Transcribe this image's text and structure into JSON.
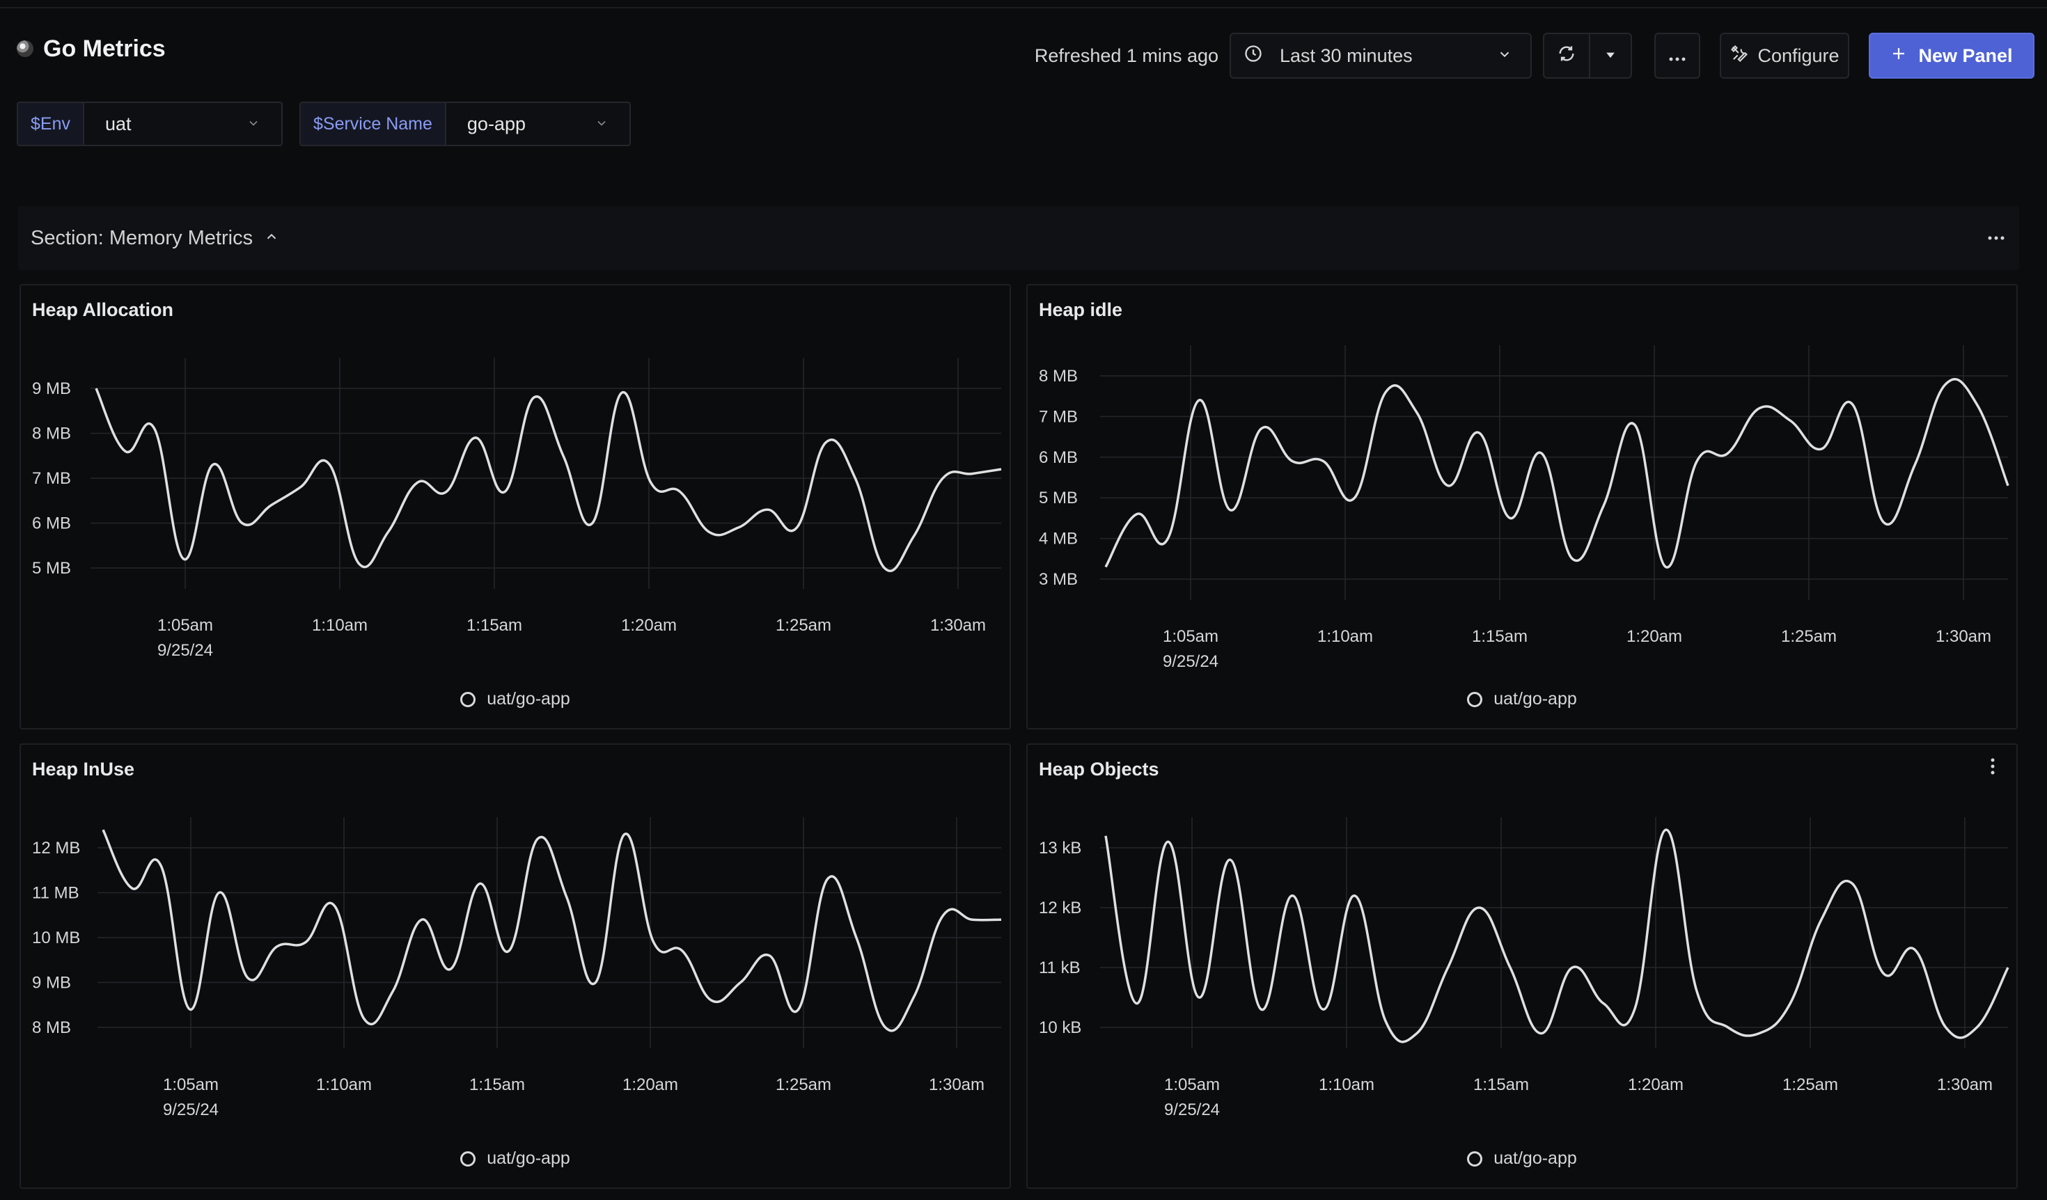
{
  "header": {
    "title": "Go Metrics",
    "refreshed": "Refreshed 1 mins ago",
    "time_range": "Last 30 minutes",
    "configure_label": "Configure",
    "new_panel_label": "New Panel"
  },
  "variables": [
    {
      "label": "$Env",
      "value": "uat"
    },
    {
      "label": "$Service Name",
      "value": "go-app"
    }
  ],
  "section": {
    "title": "Section: Memory Metrics"
  },
  "colors": {
    "accent": "#4e62d6",
    "line": "#e0e0e0",
    "variable_label": "#8a9cf3"
  },
  "panels": [
    {
      "title": "Heap Allocation",
      "legend": "uat/go-app"
    },
    {
      "title": "Heap idle",
      "legend": "uat/go-app"
    },
    {
      "title": "Heap InUse",
      "legend": "uat/go-app"
    },
    {
      "title": "Heap Objects",
      "legend": "uat/go-app"
    }
  ],
  "chart_data": [
    {
      "type": "line",
      "title": "Heap Allocation",
      "x_ticks": [
        "1:05am",
        "1:10am",
        "1:15am",
        "1:20am",
        "1:25am",
        "1:30am"
      ],
      "x_date": "9/25/24",
      "y_ticks": [
        "9 MB",
        "8 MB",
        "7 MB",
        "6 MB",
        "5 MB"
      ],
      "ylim": [
        5,
        9
      ],
      "xlim": [
        0,
        31
      ],
      "unit": "MB",
      "series": [
        {
          "name": "uat/go-app",
          "x": [
            0,
            1,
            2,
            3,
            4,
            5,
            6,
            7,
            8,
            9,
            10,
            11,
            12,
            13,
            14,
            15,
            16,
            17,
            18,
            19,
            20,
            21,
            22,
            23,
            24,
            25,
            26,
            27,
            28,
            29,
            30,
            31
          ],
          "y": [
            9.0,
            7.6,
            8.1,
            5.2,
            7.3,
            6.0,
            6.4,
            6.8,
            7.3,
            5.1,
            5.8,
            6.9,
            6.7,
            7.9,
            6.7,
            8.8,
            7.5,
            6.0,
            8.9,
            6.9,
            6.7,
            5.8,
            5.9,
            6.3,
            5.9,
            7.8,
            7.0,
            5.0,
            5.7,
            7.0,
            7.1,
            7.2
          ]
        }
      ]
    },
    {
      "type": "line",
      "title": "Heap idle",
      "x_ticks": [
        "1:05am",
        "1:10am",
        "1:15am",
        "1:20am",
        "1:25am",
        "1:30am"
      ],
      "x_date": "9/25/24",
      "y_ticks": [
        "8 MB",
        "7 MB",
        "6 MB",
        "5 MB",
        "4 MB",
        "3 MB"
      ],
      "ylim": [
        3,
        8
      ],
      "xlim": [
        0,
        29
      ],
      "unit": "MB",
      "series": [
        {
          "name": "uat/go-app",
          "x": [
            0,
            1,
            2,
            3,
            4,
            5,
            6,
            7,
            8,
            9,
            10,
            11,
            12,
            13,
            14,
            15,
            16,
            17,
            18,
            19,
            20,
            21,
            22,
            23,
            24,
            25,
            26,
            27,
            28,
            29
          ],
          "y": [
            3.3,
            4.6,
            4.0,
            7.4,
            4.7,
            6.7,
            5.9,
            5.9,
            5.0,
            7.6,
            7.1,
            5.3,
            6.6,
            4.5,
            6.1,
            3.5,
            4.8,
            6.8,
            3.3,
            5.9,
            6.1,
            7.2,
            6.9,
            6.2,
            7.3,
            4.4,
            5.8,
            7.8,
            7.3,
            5.3
          ]
        }
      ]
    },
    {
      "type": "line",
      "title": "Heap InUse",
      "x_ticks": [
        "1:05am",
        "1:10am",
        "1:15am",
        "1:20am",
        "1:25am",
        "1:30am"
      ],
      "x_date": "9/25/24",
      "y_ticks": [
        "12 MB",
        "11 MB",
        "10 MB",
        "9 MB",
        "8 MB"
      ],
      "ylim": [
        8,
        12
      ],
      "xlim": [
        0,
        31
      ],
      "unit": "MB",
      "series": [
        {
          "name": "uat/go-app",
          "x": [
            0,
            1,
            2,
            3,
            4,
            5,
            6,
            7,
            8,
            9,
            10,
            11,
            12,
            13,
            14,
            15,
            16,
            17,
            18,
            19,
            20,
            21,
            22,
            23,
            24,
            25,
            26,
            27,
            28,
            29,
            30,
            31
          ],
          "y": [
            12.4,
            11.1,
            11.6,
            8.4,
            11.0,
            9.1,
            9.8,
            9.9,
            10.7,
            8.2,
            8.8,
            10.4,
            9.3,
            11.2,
            9.7,
            12.2,
            10.9,
            9.0,
            12.3,
            9.9,
            9.7,
            8.6,
            9.0,
            9.6,
            8.4,
            11.3,
            10.0,
            8.0,
            8.7,
            10.5,
            10.4,
            10.4
          ]
        }
      ]
    },
    {
      "type": "line",
      "title": "Heap Objects",
      "x_ticks": [
        "1:05am",
        "1:10am",
        "1:15am",
        "1:20am",
        "1:25am",
        "1:30am"
      ],
      "x_date": "9/25/24",
      "y_ticks": [
        "13 kB",
        "12 kB",
        "11 kB",
        "10 kB"
      ],
      "ylim": [
        10,
        13
      ],
      "xlim": [
        0,
        29
      ],
      "unit": "kB",
      "series": [
        {
          "name": "uat/go-app",
          "x": [
            0,
            1,
            2,
            3,
            4,
            5,
            6,
            7,
            8,
            9,
            10,
            11,
            12,
            13,
            14,
            15,
            16,
            17,
            18,
            19,
            20,
            21,
            22,
            23,
            24,
            25,
            26,
            27,
            28,
            29
          ],
          "y": [
            13.2,
            10.4,
            13.1,
            10.5,
            12.8,
            10.3,
            12.2,
            10.3,
            12.2,
            10.1,
            9.9,
            11.0,
            12.0,
            11.0,
            9.9,
            11.0,
            10.4,
            10.3,
            13.3,
            10.6,
            10.0,
            9.9,
            10.4,
            11.8,
            12.4,
            10.9,
            11.3,
            10.0,
            10.0,
            11.0
          ]
        }
      ]
    }
  ]
}
